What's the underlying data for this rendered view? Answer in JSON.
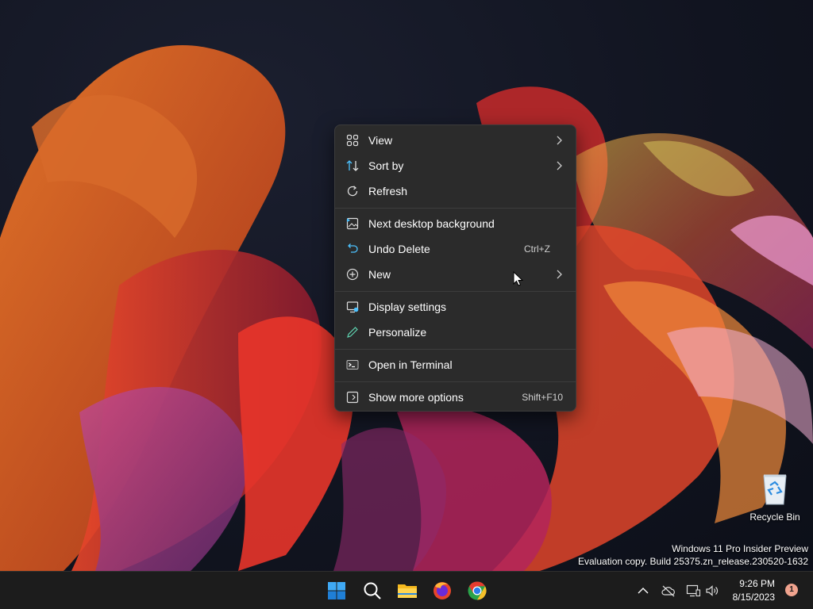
{
  "context_menu": {
    "items": [
      {
        "label": "View",
        "icon": "view-grid-icon",
        "submenu": true
      },
      {
        "label": "Sort by",
        "icon": "sort-icon",
        "submenu": true
      },
      {
        "label": "Refresh",
        "icon": "refresh-icon"
      },
      {
        "label": "Next desktop background",
        "icon": "desktop-background-icon"
      },
      {
        "label": "Undo Delete",
        "icon": "undo-icon",
        "shortcut": "Ctrl+Z"
      },
      {
        "label": "New",
        "icon": "new-plus-icon",
        "submenu": true
      },
      {
        "label": "Display settings",
        "icon": "display-icon"
      },
      {
        "label": "Personalize",
        "icon": "pencil-icon"
      },
      {
        "label": "Open in Terminal",
        "icon": "terminal-icon"
      },
      {
        "label": "Show more options",
        "icon": "more-options-icon",
        "shortcut": "Shift+F10"
      }
    ]
  },
  "desktop": {
    "recycle_bin_label": "Recycle Bin",
    "watermark_line1": "Windows 11 Pro Insider Preview",
    "watermark_line2": "Evaluation copy. Build 25375.zn_release.230520-1632"
  },
  "taskbar": {
    "apps": [
      "windows-start-icon",
      "search-icon",
      "file-explorer-icon",
      "firefox-icon",
      "chrome-icon"
    ],
    "tray": [
      "chevron-up-icon",
      "onedrive-offline-icon",
      "network-icon",
      "volume-icon"
    ],
    "time": "9:26 PM",
    "date": "8/15/2023",
    "notification_count": "1"
  },
  "colors": {
    "menu_bg": "#2b2b2b",
    "taskbar_bg": "#1c1c1c",
    "accent_blue": "#4cc2ff"
  }
}
